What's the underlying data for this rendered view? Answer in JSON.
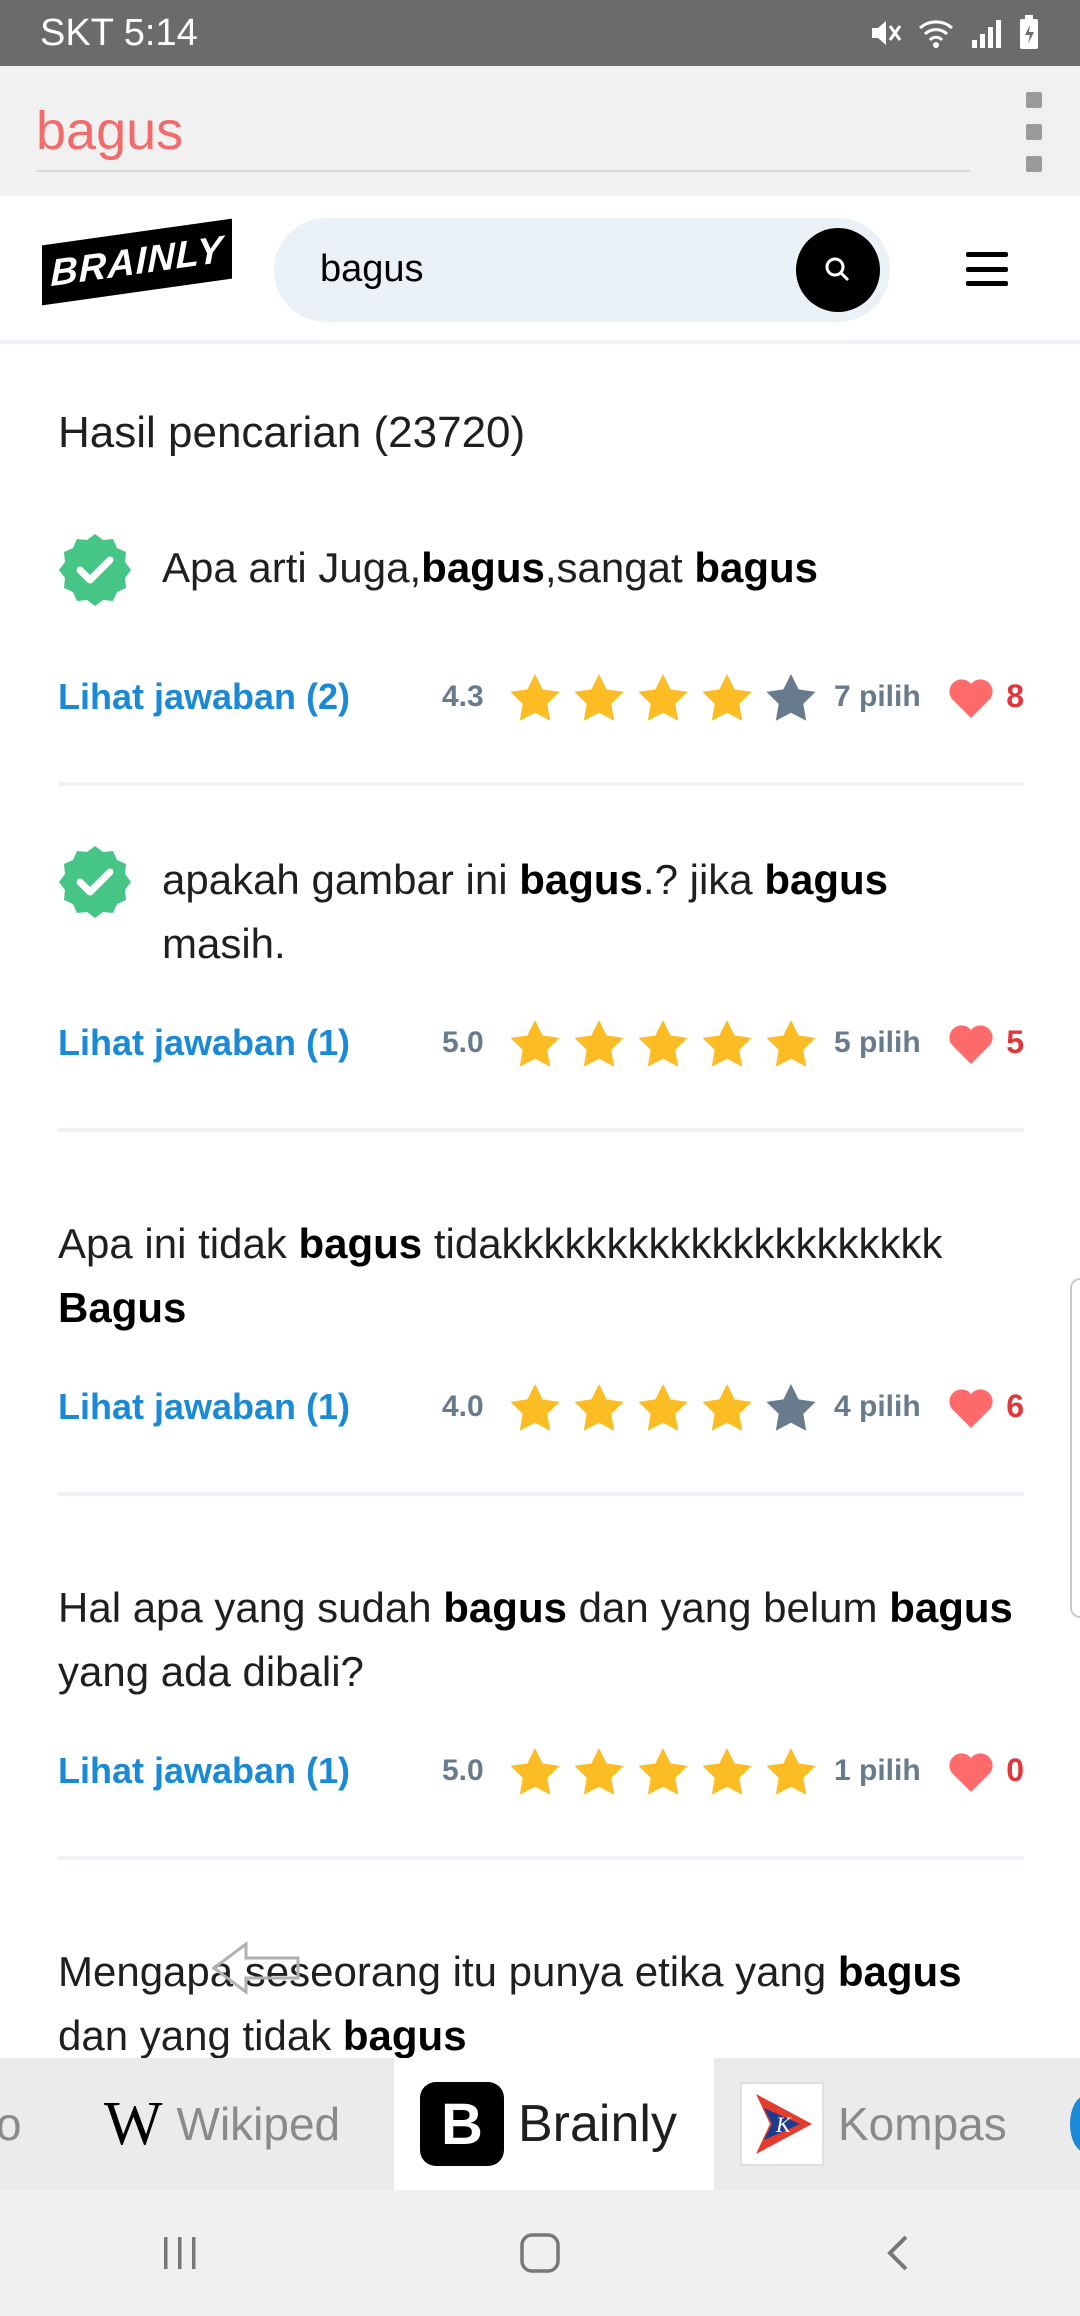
{
  "status_bar": {
    "carrier_time": "SKT 5:14",
    "icons": [
      "mute-icon",
      "wifi-icon",
      "signal-icon",
      "battery-charging-icon"
    ]
  },
  "query_bar": {
    "query": "bagus",
    "menu_icon": "kebab-menu-icon"
  },
  "header": {
    "logo_text": "BRAINLY",
    "search_value": "bagus",
    "search_icon": "search-icon",
    "menu_icon": "hamburger-menu-icon"
  },
  "results": {
    "title": "Hasil pencarian (23720)",
    "items": [
      {
        "verified": true,
        "segments": [
          {
            "t": "Apa arti Juga,",
            "b": false
          },
          {
            "t": "bagus",
            "b": true
          },
          {
            "t": ",sangat ",
            "b": false
          },
          {
            "t": "bagus",
            "b": true
          }
        ],
        "answers_label": "Lihat jawaban (2)",
        "rating": "4.3",
        "rating_value": 4.3,
        "pilih": "7 pilih",
        "likes": "8"
      },
      {
        "verified": true,
        "segments": [
          {
            "t": "apakah gambar ini ",
            "b": false
          },
          {
            "t": "bagus",
            "b": true
          },
          {
            "t": ".? jika ",
            "b": false
          },
          {
            "t": "bagus",
            "b": true
          },
          {
            "t": " masih.",
            "b": false
          }
        ],
        "answers_label": "Lihat jawaban (1)",
        "rating": "5.0",
        "rating_value": 5.0,
        "pilih": "5 pilih",
        "likes": "5"
      },
      {
        "verified": false,
        "segments": [
          {
            "t": "Apa ini tidak ",
            "b": false
          },
          {
            "t": "bagus",
            "b": true
          },
          {
            "t": " tidakkkkkkkkkkkkkkkkkkkkk ",
            "b": false
          },
          {
            "t": "Bagus",
            "b": true
          }
        ],
        "answers_label": "Lihat jawaban (1)",
        "rating": "4.0",
        "rating_value": 4.0,
        "pilih": "4 pilih",
        "likes": "6"
      },
      {
        "verified": false,
        "segments": [
          {
            "t": "Hal apa yang sudah ",
            "b": false
          },
          {
            "t": "bagus",
            "b": true
          },
          {
            "t": " dan yang belum ",
            "b": false
          },
          {
            "t": "bagus",
            "b": true
          },
          {
            "t": " yang ada dibali?",
            "b": false
          }
        ],
        "answers_label": "Lihat jawaban (1)",
        "rating": "5.0",
        "rating_value": 5.0,
        "pilih": "1 pilih",
        "likes": "0"
      },
      {
        "verified": false,
        "segments": [
          {
            "t": "Mengapa seseorang itu punya etika yang ",
            "b": false
          },
          {
            "t": "bagus",
            "b": true
          },
          {
            "t": " dan yang tidak ",
            "b": false
          },
          {
            "t": "bagus",
            "b": true
          }
        ]
      }
    ]
  },
  "tabs": [
    {
      "label": "o",
      "active": false
    },
    {
      "label": "Wikiped",
      "active": false,
      "icon": "wikipedia-icon"
    },
    {
      "label": "Brainly",
      "active": true,
      "icon": "brainly-icon"
    },
    {
      "label": "Kompas",
      "active": false,
      "icon": "kompas-icon"
    }
  ],
  "nav": {
    "recent": "recent-apps-icon",
    "home": "home-icon",
    "back": "back-icon"
  },
  "colors": {
    "accent_link": "#1a8ad7",
    "star": "#fbbd23",
    "star_empty": "#687b8c",
    "heart": "#ff6a6a",
    "likes_text": "#e2363a",
    "verified": "#45c586",
    "query_text": "#f26a6a"
  }
}
